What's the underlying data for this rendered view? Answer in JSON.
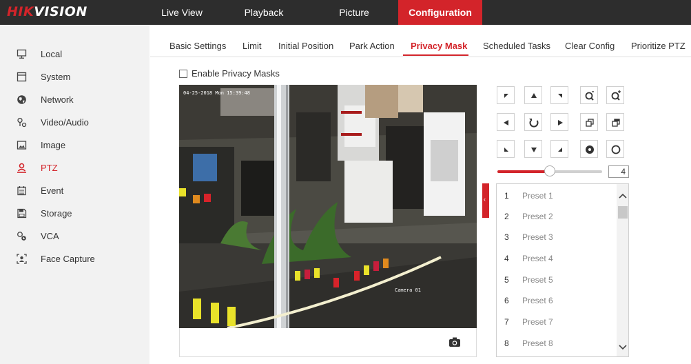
{
  "header": {
    "logo_text": "HIKVISION",
    "nav": [
      {
        "label": "Live View"
      },
      {
        "label": "Playback"
      },
      {
        "label": "Picture"
      },
      {
        "label": "Configuration",
        "active": true
      }
    ]
  },
  "sidebar": {
    "items": [
      {
        "label": "Local",
        "icon": "monitor-icon"
      },
      {
        "label": "System",
        "icon": "system-icon"
      },
      {
        "label": "Network",
        "icon": "globe-icon"
      },
      {
        "label": "Video/Audio",
        "icon": "video-audio-icon"
      },
      {
        "label": "Image",
        "icon": "image-icon"
      },
      {
        "label": "PTZ",
        "icon": "ptz-user-icon",
        "active": true
      },
      {
        "label": "Event",
        "icon": "event-calendar-icon"
      },
      {
        "label": "Storage",
        "icon": "storage-icon"
      },
      {
        "label": "VCA",
        "icon": "vca-icon"
      },
      {
        "label": "Face Capture",
        "icon": "face-capture-icon"
      }
    ]
  },
  "tabs": [
    {
      "label": "Basic Settings"
    },
    {
      "label": "Limit"
    },
    {
      "label": "Initial Position"
    },
    {
      "label": "Park Action"
    },
    {
      "label": "Privacy Mask",
      "active": true
    },
    {
      "label": "Scheduled Tasks"
    },
    {
      "label": "Clear Config"
    },
    {
      "label": "Prioritize PTZ"
    }
  ],
  "privacy_mask": {
    "enable_label": "Enable Privacy Masks",
    "enabled": false
  },
  "video": {
    "osd_timestamp": "04-25-2018 Mon 15:39:48",
    "osd_camera": "Camera 01"
  },
  "ptz": {
    "buttons": [
      "pan-up-left",
      "pan-up",
      "pan-up-right",
      "zoom-in",
      "zoom-out",
      "pan-left",
      "auto-rotate",
      "pan-right",
      "focus-near",
      "focus-far",
      "pan-down-left",
      "pan-down",
      "pan-down-right",
      "iris-open",
      "iris-close"
    ],
    "speed_value": "4",
    "speed_fraction": 0.5
  },
  "presets": [
    {
      "num": "1",
      "name": "Preset 1"
    },
    {
      "num": "2",
      "name": "Preset 2"
    },
    {
      "num": "3",
      "name": "Preset 3"
    },
    {
      "num": "4",
      "name": "Preset 4"
    },
    {
      "num": "5",
      "name": "Preset 5"
    },
    {
      "num": "6",
      "name": "Preset 6"
    },
    {
      "num": "7",
      "name": "Preset 7"
    },
    {
      "num": "8",
      "name": "Preset 8"
    }
  ],
  "colors": {
    "accent": "#d3242a",
    "topbar": "#2d2d2d",
    "sidebar": "#f2f2f2"
  }
}
